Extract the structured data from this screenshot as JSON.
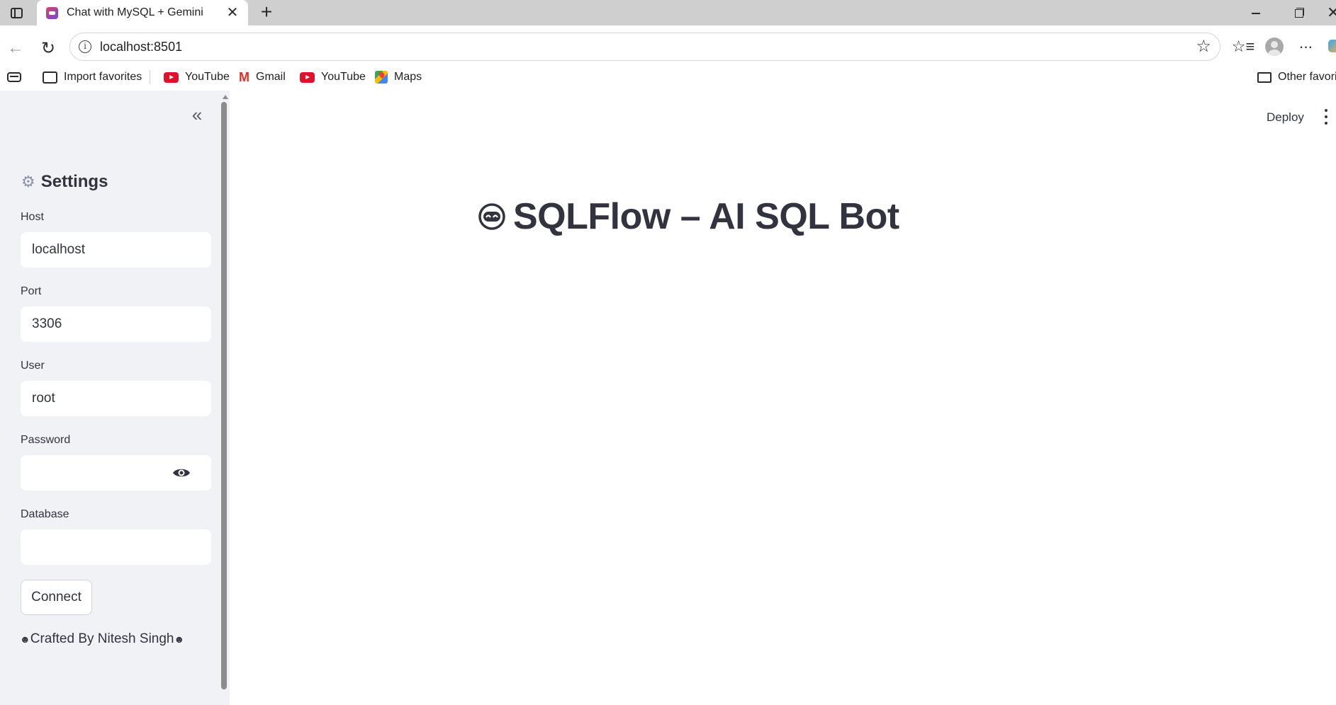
{
  "browser": {
    "tab_title": "Chat with MySQL + Gemini",
    "tab_close": "✕",
    "new_tab": "+",
    "url": "localhost:8501",
    "bookmarks": {
      "import": "Import favorites",
      "youtube_1": "YouTube",
      "gmail": "Gmail",
      "youtube_2": "YouTube",
      "maps": "Maps",
      "other": "Other favorites"
    },
    "icons": [
      "tab-actions-icon",
      "back-icon",
      "reload-icon",
      "info-icon",
      "star-icon",
      "favorites-icon",
      "profile-icon",
      "more-icon",
      "minimize-icon",
      "maximize-icon",
      "close-icon"
    ]
  },
  "sidebar": {
    "collapse_glyph": "«",
    "settings_icon": "⚙",
    "settings_title": "Settings",
    "fields": {
      "host": {
        "label": "Host",
        "value": "localhost"
      },
      "port": {
        "label": "Port",
        "value": "3306"
      },
      "user": {
        "label": "User",
        "value": "root"
      },
      "password": {
        "label": "Password",
        "value": ""
      },
      "database": {
        "label": "Database",
        "value": ""
      }
    },
    "connect_label": "Connect",
    "credit": "Crafted By Nitesh Singh"
  },
  "header": {
    "deploy_label": "Deploy"
  },
  "main": {
    "title": "SQLFlow – AI SQL Bot"
  },
  "colors": {
    "sidebar_bg": "#f0f2f6",
    "text": "#31333f",
    "tabstrip_bg": "#cfcfcf"
  }
}
